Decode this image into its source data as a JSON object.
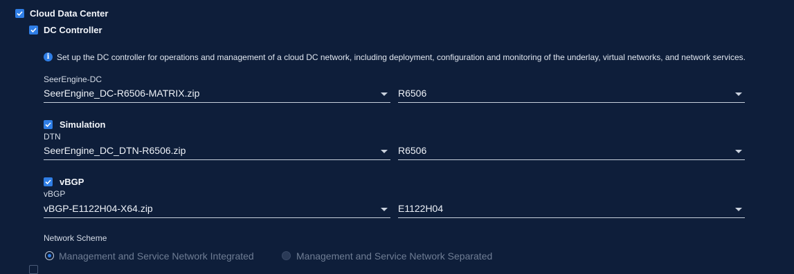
{
  "cloud_data_center": {
    "label": "Cloud Data Center",
    "checked": true
  },
  "dc_controller": {
    "label": "DC Controller",
    "checked": true,
    "info_icon": "info-icon",
    "info_text": "Set up the DC controller for operations and management of a cloud DC network, including deployment, configuration and monitoring of the underlay, virtual networks, and network services.",
    "seerengine": {
      "label": "SeerEngine-DC",
      "package": "SeerEngine_DC-R6506-MATRIX.zip",
      "version": "R6506"
    }
  },
  "simulation": {
    "label": "Simulation",
    "checked": true,
    "sub_label": "DTN",
    "package": "SeerEngine_DC_DTN-R6506.zip",
    "version": "R6506"
  },
  "vbgp": {
    "label": "vBGP",
    "checked": true,
    "sub_label": "vBGP",
    "package": "vBGP-E1122H04-X64.zip",
    "version": "E1122H04"
  },
  "network_scheme": {
    "label": "Network Scheme",
    "options": [
      {
        "label": "Management and Service Network Integrated",
        "selected": true
      },
      {
        "label": "Management and Service Network Separated",
        "selected": false
      }
    ]
  },
  "colors": {
    "background": "#0e1e3a",
    "accent": "#2f7ee6",
    "text": "#e6ecf5",
    "muted": "#6f7d94"
  }
}
